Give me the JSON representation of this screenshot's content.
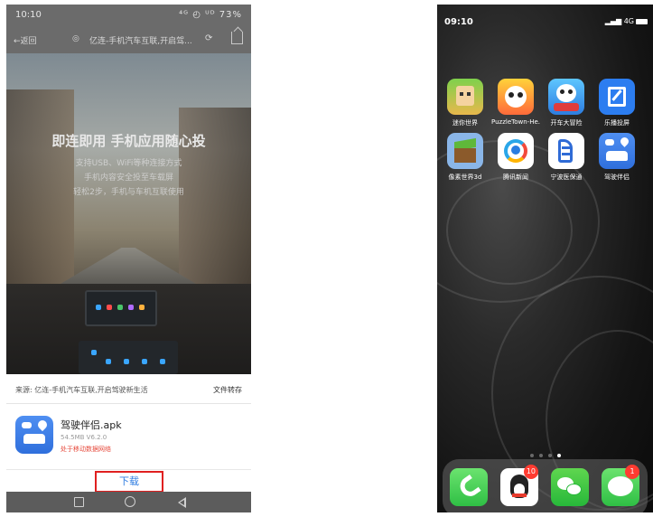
{
  "left_phone": {
    "status": {
      "time": "10:10",
      "indicators": "⁴ᴳ ◴ ᵁᴰ 73%"
    },
    "toolbar": {
      "back_label": "←返回",
      "favicon": "◎",
      "page_title": "亿连-手机汽车互联,开启驾...",
      "reload": "⟳"
    },
    "hero": {
      "headline": "即连即用 手机应用随心投",
      "lines": [
        "支持USB、WiFi等种连接方式",
        "手机内容安全投至车载屏",
        "轻松2步，手机与车机互联使用"
      ]
    },
    "download_sheet": {
      "source": "来源: 亿连-手机汽车互联,开启驾驶新生活",
      "save_label": "文件转存",
      "file_name": "驾驶伴侣.apk",
      "file_meta": "54.5MB V6.2.0",
      "warning": "处于移动数据网络",
      "download_label": "下载"
    },
    "colors": {
      "download_text": "#2f7de1",
      "highlight_border": "#e02020",
      "warning": "#e64a3c"
    }
  },
  "right_phone": {
    "status": {
      "time": "09:10",
      "signal": "4G"
    },
    "apps": [
      {
        "label": "迷你世界",
        "icon": "mini-world-icon"
      },
      {
        "label": "PuzzleTown-He...",
        "icon": "puzzle-town-icon"
      },
      {
        "label": "开车大冒险",
        "icon": "driving-adventure-icon"
      },
      {
        "label": "乐播投屏",
        "icon": "lebo-cast-icon"
      },
      {
        "label": "像素世界3d",
        "icon": "pixel-world-icon"
      },
      {
        "label": "腾讯新闻",
        "icon": "tencent-news-icon"
      },
      {
        "label": "宁波医保通",
        "icon": "ningbo-medical-icon"
      },
      {
        "label": "驾驶伴侣",
        "icon": "driving-companion-icon"
      }
    ],
    "dock": [
      {
        "name": "phone",
        "icon": "phone-icon",
        "badge": ""
      },
      {
        "name": "qq",
        "icon": "qq-penguin-icon",
        "badge": "10"
      },
      {
        "name": "wechat",
        "icon": "wechat-icon",
        "badge": ""
      },
      {
        "name": "messages",
        "icon": "messages-icon",
        "badge": "1"
      }
    ]
  }
}
